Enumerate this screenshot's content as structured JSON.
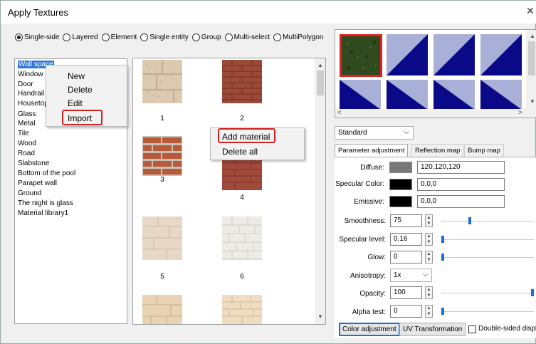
{
  "window": {
    "title": "Apply Textures",
    "close_glyph": "✕"
  },
  "modes": [
    {
      "label": "Single-side",
      "selected": true
    },
    {
      "label": "Layered",
      "selected": false
    },
    {
      "label": "Element",
      "selected": false
    },
    {
      "label": "Single entity",
      "selected": false
    },
    {
      "label": "Group",
      "selected": false
    },
    {
      "label": "Multi-select",
      "selected": false
    },
    {
      "label": "MultiPolygon",
      "selected": false
    }
  ],
  "categories": [
    "Wall space",
    "Window",
    "Door",
    "Handrail",
    "Housetop",
    "Glass",
    "Metal",
    "Tile",
    "Wood",
    "Road",
    "Slabstone",
    "Bottom of the pool",
    "Parapet wall",
    "Ground",
    "The night is glass",
    "Material library1"
  ],
  "category_context_menu": [
    "New",
    "Delete",
    "Edit",
    "Import"
  ],
  "gallery_context_menu": [
    "Add material",
    "Delete all"
  ],
  "thumbnails": [
    {
      "label": "1",
      "pattern": "granite-tiles"
    },
    {
      "label": "2",
      "pattern": "red-brick"
    },
    {
      "label": "3",
      "pattern": "red-brick"
    },
    {
      "label": "4",
      "pattern": "red-brick"
    },
    {
      "label": "5",
      "pattern": "beige-stone"
    },
    {
      "label": "6",
      "pattern": "grey-brick"
    },
    {
      "label": "",
      "pattern": "sand-stone"
    },
    {
      "label": "",
      "pattern": "sand-brick"
    }
  ],
  "preview_colors": {
    "selected_green": "#2e4a1e",
    "tile_blue": "#0a0a88",
    "tile_light": "#a8b0d8",
    "highlight": "#e02020"
  },
  "material_type": "Standard",
  "tabs": [
    "Parameter adjustment",
    "Reflection map",
    "Bump map"
  ],
  "params": {
    "diffuse": {
      "label": "Diffuse:",
      "value": "120,120,120",
      "color": "#787878"
    },
    "specular_color": {
      "label": "Specular Color:",
      "value": "0,0,0",
      "color": "#000000"
    },
    "emissive": {
      "label": "Emissive:",
      "value": "0,0,0",
      "color": "#000000"
    },
    "smoothness": {
      "label": "Smoothness:",
      "value": "75",
      "level": 0.3
    },
    "specular_level": {
      "label": "Specular level:",
      "value": "0.16",
      "level": 0.0
    },
    "glow": {
      "label": "Glow:",
      "value": "0",
      "level": 0.0
    },
    "anisotropy": {
      "label": "Anisotropy:",
      "value": "1x"
    },
    "opacity": {
      "label": "Opacity:",
      "value": "100",
      "level": 1.0
    },
    "alpha_test": {
      "label": "Alpha test:",
      "value": "0",
      "level": 0.0
    }
  },
  "buttons": {
    "color_adjustment": "Color adjustment",
    "uv_transformation": "UV Transformation"
  },
  "double_sided": {
    "label": "Double-sided display",
    "checked": false
  },
  "arrows": {
    "up": "▲",
    "down": "▼",
    "left": "<",
    "right": ">",
    "dropdown": "⌵"
  }
}
